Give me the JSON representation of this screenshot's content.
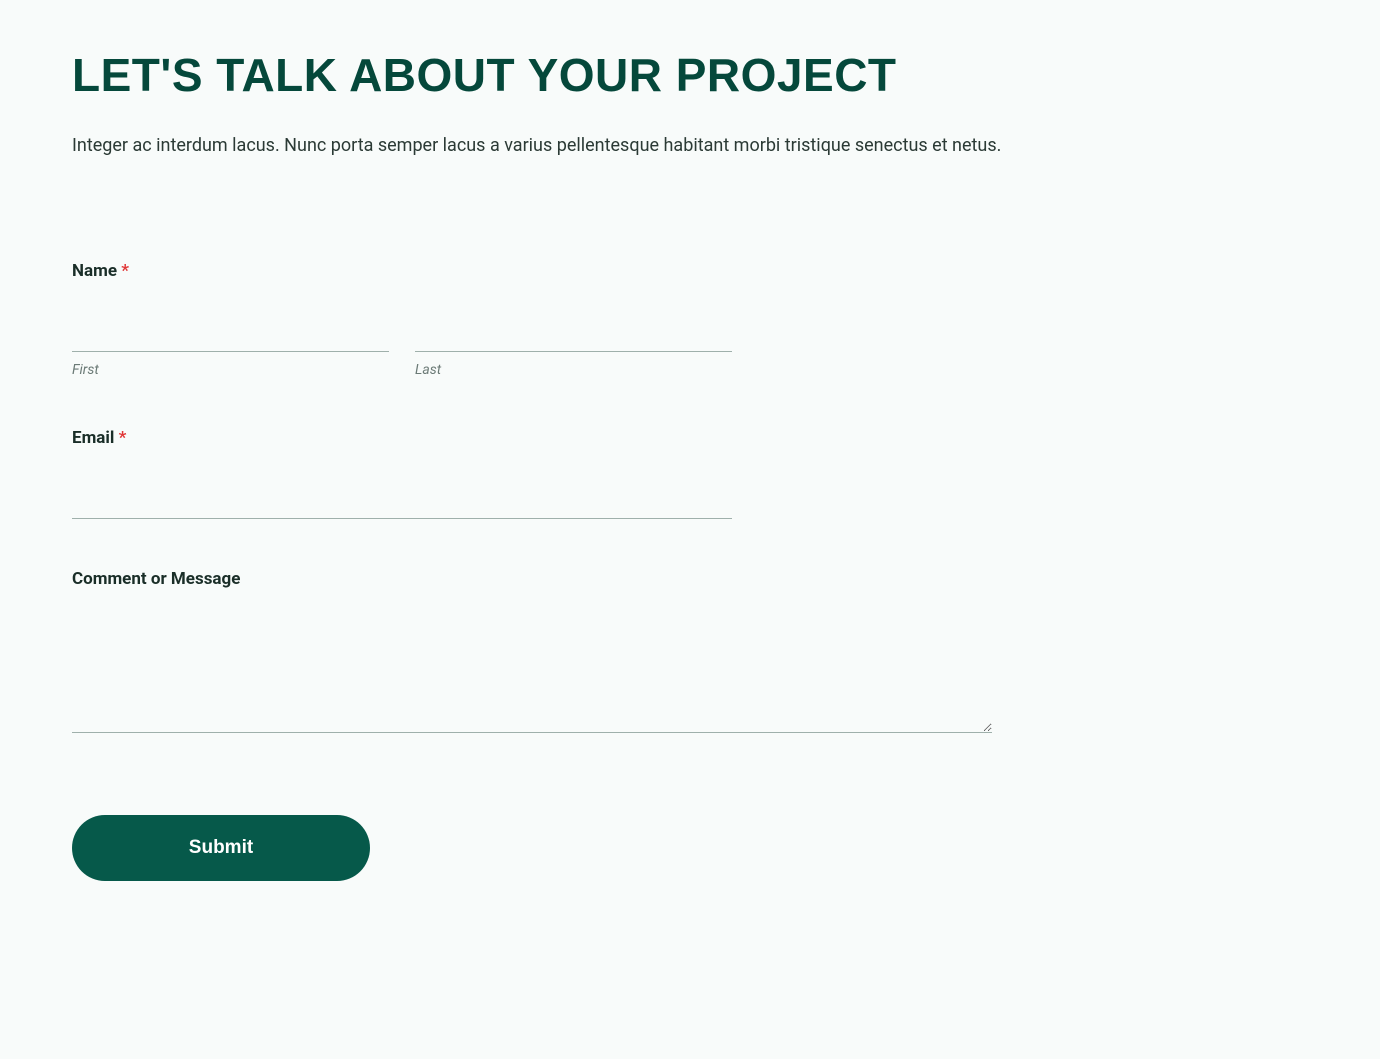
{
  "heading": "LET'S TALK ABOUT YOUR PROJECT",
  "intro": "Integer ac interdum lacus. Nunc porta semper lacus a varius pellentesque habitant morbi tristique senectus et netus.",
  "fields": {
    "name": {
      "label": "Name",
      "required_marker": "*",
      "first_sub": "First",
      "last_sub": "Last",
      "first_value": "",
      "last_value": ""
    },
    "email": {
      "label": "Email",
      "required_marker": "*",
      "value": ""
    },
    "comment": {
      "label": "Comment or Message",
      "value": ""
    }
  },
  "submit_label": "Submit"
}
